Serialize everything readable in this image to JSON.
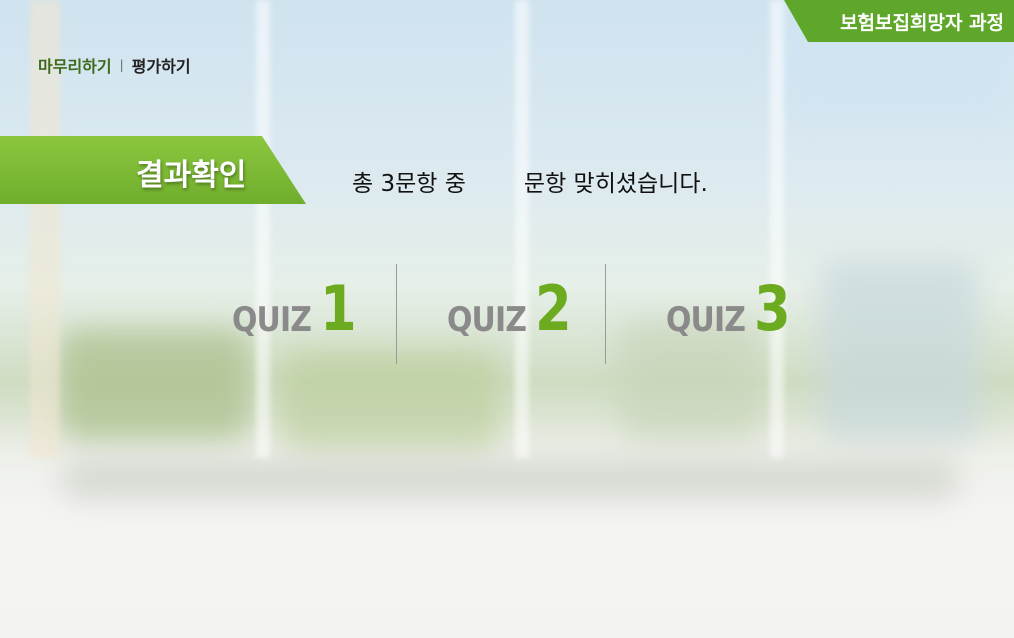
{
  "header": {
    "course_badge": "보험보집희망자 과정"
  },
  "breadcrumb": {
    "section": "마무리하기",
    "current": "평가하기"
  },
  "result": {
    "tag_label": "결과확인",
    "message_prefix": "총 3문항 중",
    "message_suffix": "문항 맞히셨습니다."
  },
  "quizzes": [
    {
      "label": "QUIZ",
      "number": "1"
    },
    {
      "label": "QUIZ",
      "number": "2"
    },
    {
      "label": "QUIZ",
      "number": "3"
    }
  ],
  "colors": {
    "brand_green": "#5ea72a",
    "quiz_number_green": "#6cab1f",
    "quiz_label_gray": "#8a8a8a"
  }
}
